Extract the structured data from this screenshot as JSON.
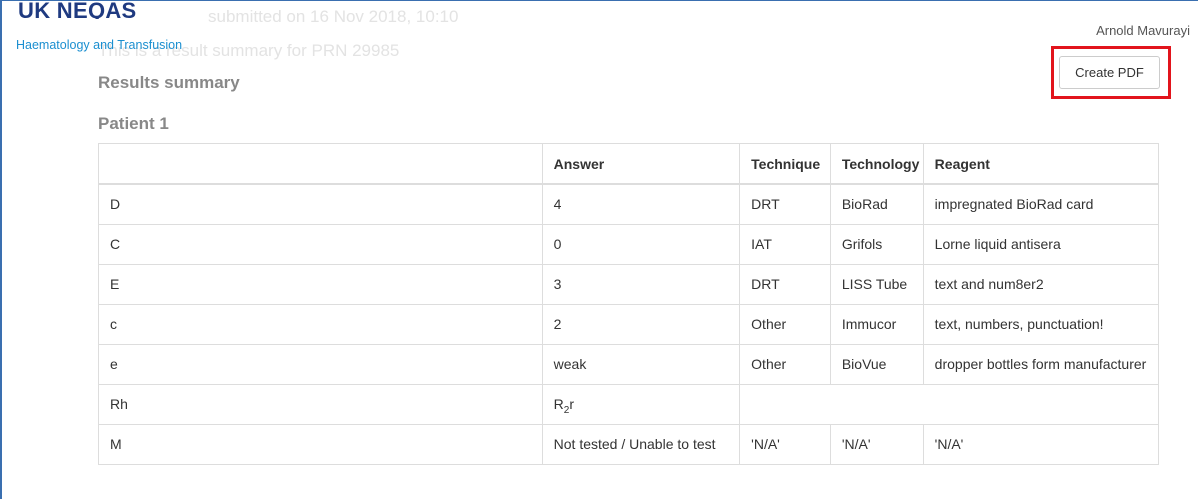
{
  "logo": {
    "main": "UK NEQAS",
    "sub": "Haematology and Transfusion"
  },
  "background": {
    "submitted": "submitted on 16 Nov 2018, 10:10",
    "summary_intro": "This is a result summary for PRN 29985"
  },
  "header": {
    "user_name": "Arnold Mavurayi",
    "create_pdf_label": "Create PDF"
  },
  "highlight_color": "#e2141c",
  "results_title": "Results summary",
  "patient_title": "Patient 1",
  "table": {
    "headers": [
      "",
      "Answer",
      "Technique",
      "Technology",
      "Reagent"
    ],
    "rows": [
      {
        "name": "D",
        "answer": "4",
        "technique": "DRT",
        "technology": "BioRad",
        "reagent": "impregnated BioRad card"
      },
      {
        "name": "C",
        "answer": "0",
        "technique": "IAT",
        "technology": "Grifols",
        "reagent": "Lorne liquid antisera"
      },
      {
        "name": "E",
        "answer": "3",
        "technique": "DRT",
        "technology": "LISS Tube",
        "reagent": "text and num8er2"
      },
      {
        "name": "c",
        "answer": "2",
        "technique": "Other",
        "technology": "Immucor",
        "reagent": "text, numbers, punctuation!"
      },
      {
        "name": "e",
        "answer": "weak",
        "technique": "Other",
        "technology": "BioVue",
        "reagent": "dropper bottles form manufacturer"
      },
      {
        "name": "Rh",
        "answer_main": "R",
        "answer_sub": "2",
        "answer_tail": "r"
      },
      {
        "name": "M",
        "answer": "Not tested / Unable to test",
        "technique": "'N/A'",
        "technology": "'N/A'",
        "reagent": "'N/A'"
      }
    ]
  }
}
